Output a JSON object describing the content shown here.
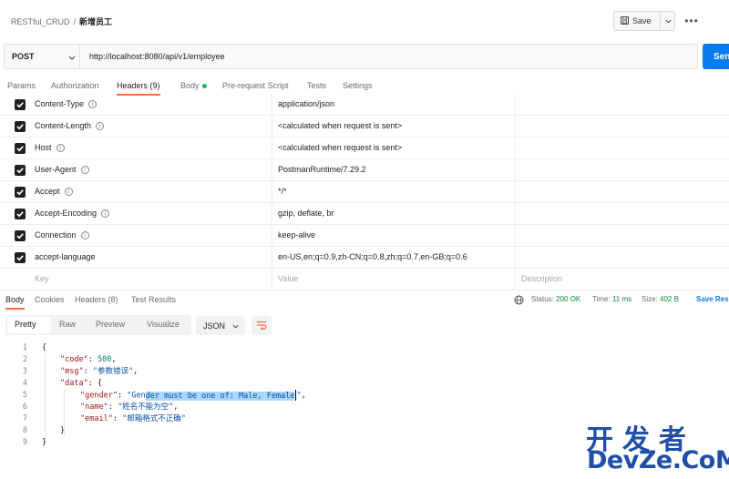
{
  "breadcrumb": {
    "collection": "RESTful_CRUD",
    "separator": "/",
    "request": "新增员工"
  },
  "toolbar": {
    "save_label": "Save",
    "more_label": "•••"
  },
  "request": {
    "method": "POST",
    "url": "http://localhost:8080/api/v1/employee",
    "send_label": "Sen"
  },
  "request_tabs": [
    "Params",
    "Authorization",
    "Headers (9)",
    "Body",
    "Pre-request Script",
    "Tests",
    "Settings"
  ],
  "headers": [
    {
      "key": "Content-Type",
      "value": "application/json",
      "info": true
    },
    {
      "key": "Content-Length",
      "value": "<calculated when request is sent>",
      "info": true
    },
    {
      "key": "Host",
      "value": "<calculated when request is sent>",
      "info": true
    },
    {
      "key": "User-Agent",
      "value": "PostmanRuntime/7.29.2",
      "info": true
    },
    {
      "key": "Accept",
      "value": "*/*",
      "info": true
    },
    {
      "key": "Accept-Encoding",
      "value": "gzip, deflate, br",
      "info": true
    },
    {
      "key": "Connection",
      "value": "keep-alive",
      "info": true
    },
    {
      "key": "accept-language",
      "value": "en-US,en;q=0.9,zh-CN;q=0.8,zh;q=0.7,en-GB;q=0.6",
      "info": false
    }
  ],
  "headers_placeholder": {
    "key": "Key",
    "value": "Value",
    "description": "Description"
  },
  "response_tabs": [
    "Body",
    "Cookies",
    "Headers (8)",
    "Test Results"
  ],
  "response_status": {
    "status_label": "Status:",
    "status": "200 OK",
    "time_label": "Time:",
    "time": "11 ms",
    "size_label": "Size:",
    "size": "402 B",
    "save_response": "Save Res"
  },
  "format_tabs": [
    "Pretty",
    "Raw",
    "Preview",
    "Visualize"
  ],
  "format_select": "JSON",
  "code_lines": [
    "1",
    "2",
    "3",
    "4",
    "5",
    "6",
    "7",
    "8",
    "9"
  ],
  "response_body": {
    "open": "{",
    "code_key": "\"code\"",
    "code_val": "500",
    "msg_key": "\"msg\"",
    "msg_val": "\"参数错误\"",
    "data_key": "\"data\"",
    "data_open": "{",
    "gender_key": "\"gender\"",
    "gender_val_pre": "\"Gen",
    "gender_val_hl": "der must be one of: Male, Female",
    "gender_val_post": "\"",
    "name_key": "\"name\"",
    "name_val": "\"姓名不能为空\"",
    "email_key": "\"email\"",
    "email_val": "\"邮箱格式不正确\"",
    "data_close": "}",
    "close": "}"
  },
  "watermark": {
    "line1": "开发者",
    "line2": "DevZe.CoM"
  },
  "colors": {
    "accent": "#ff6c37",
    "send": "#097bed",
    "status_ok": "#0c8d3e",
    "watermark": "#1f4fa8"
  }
}
